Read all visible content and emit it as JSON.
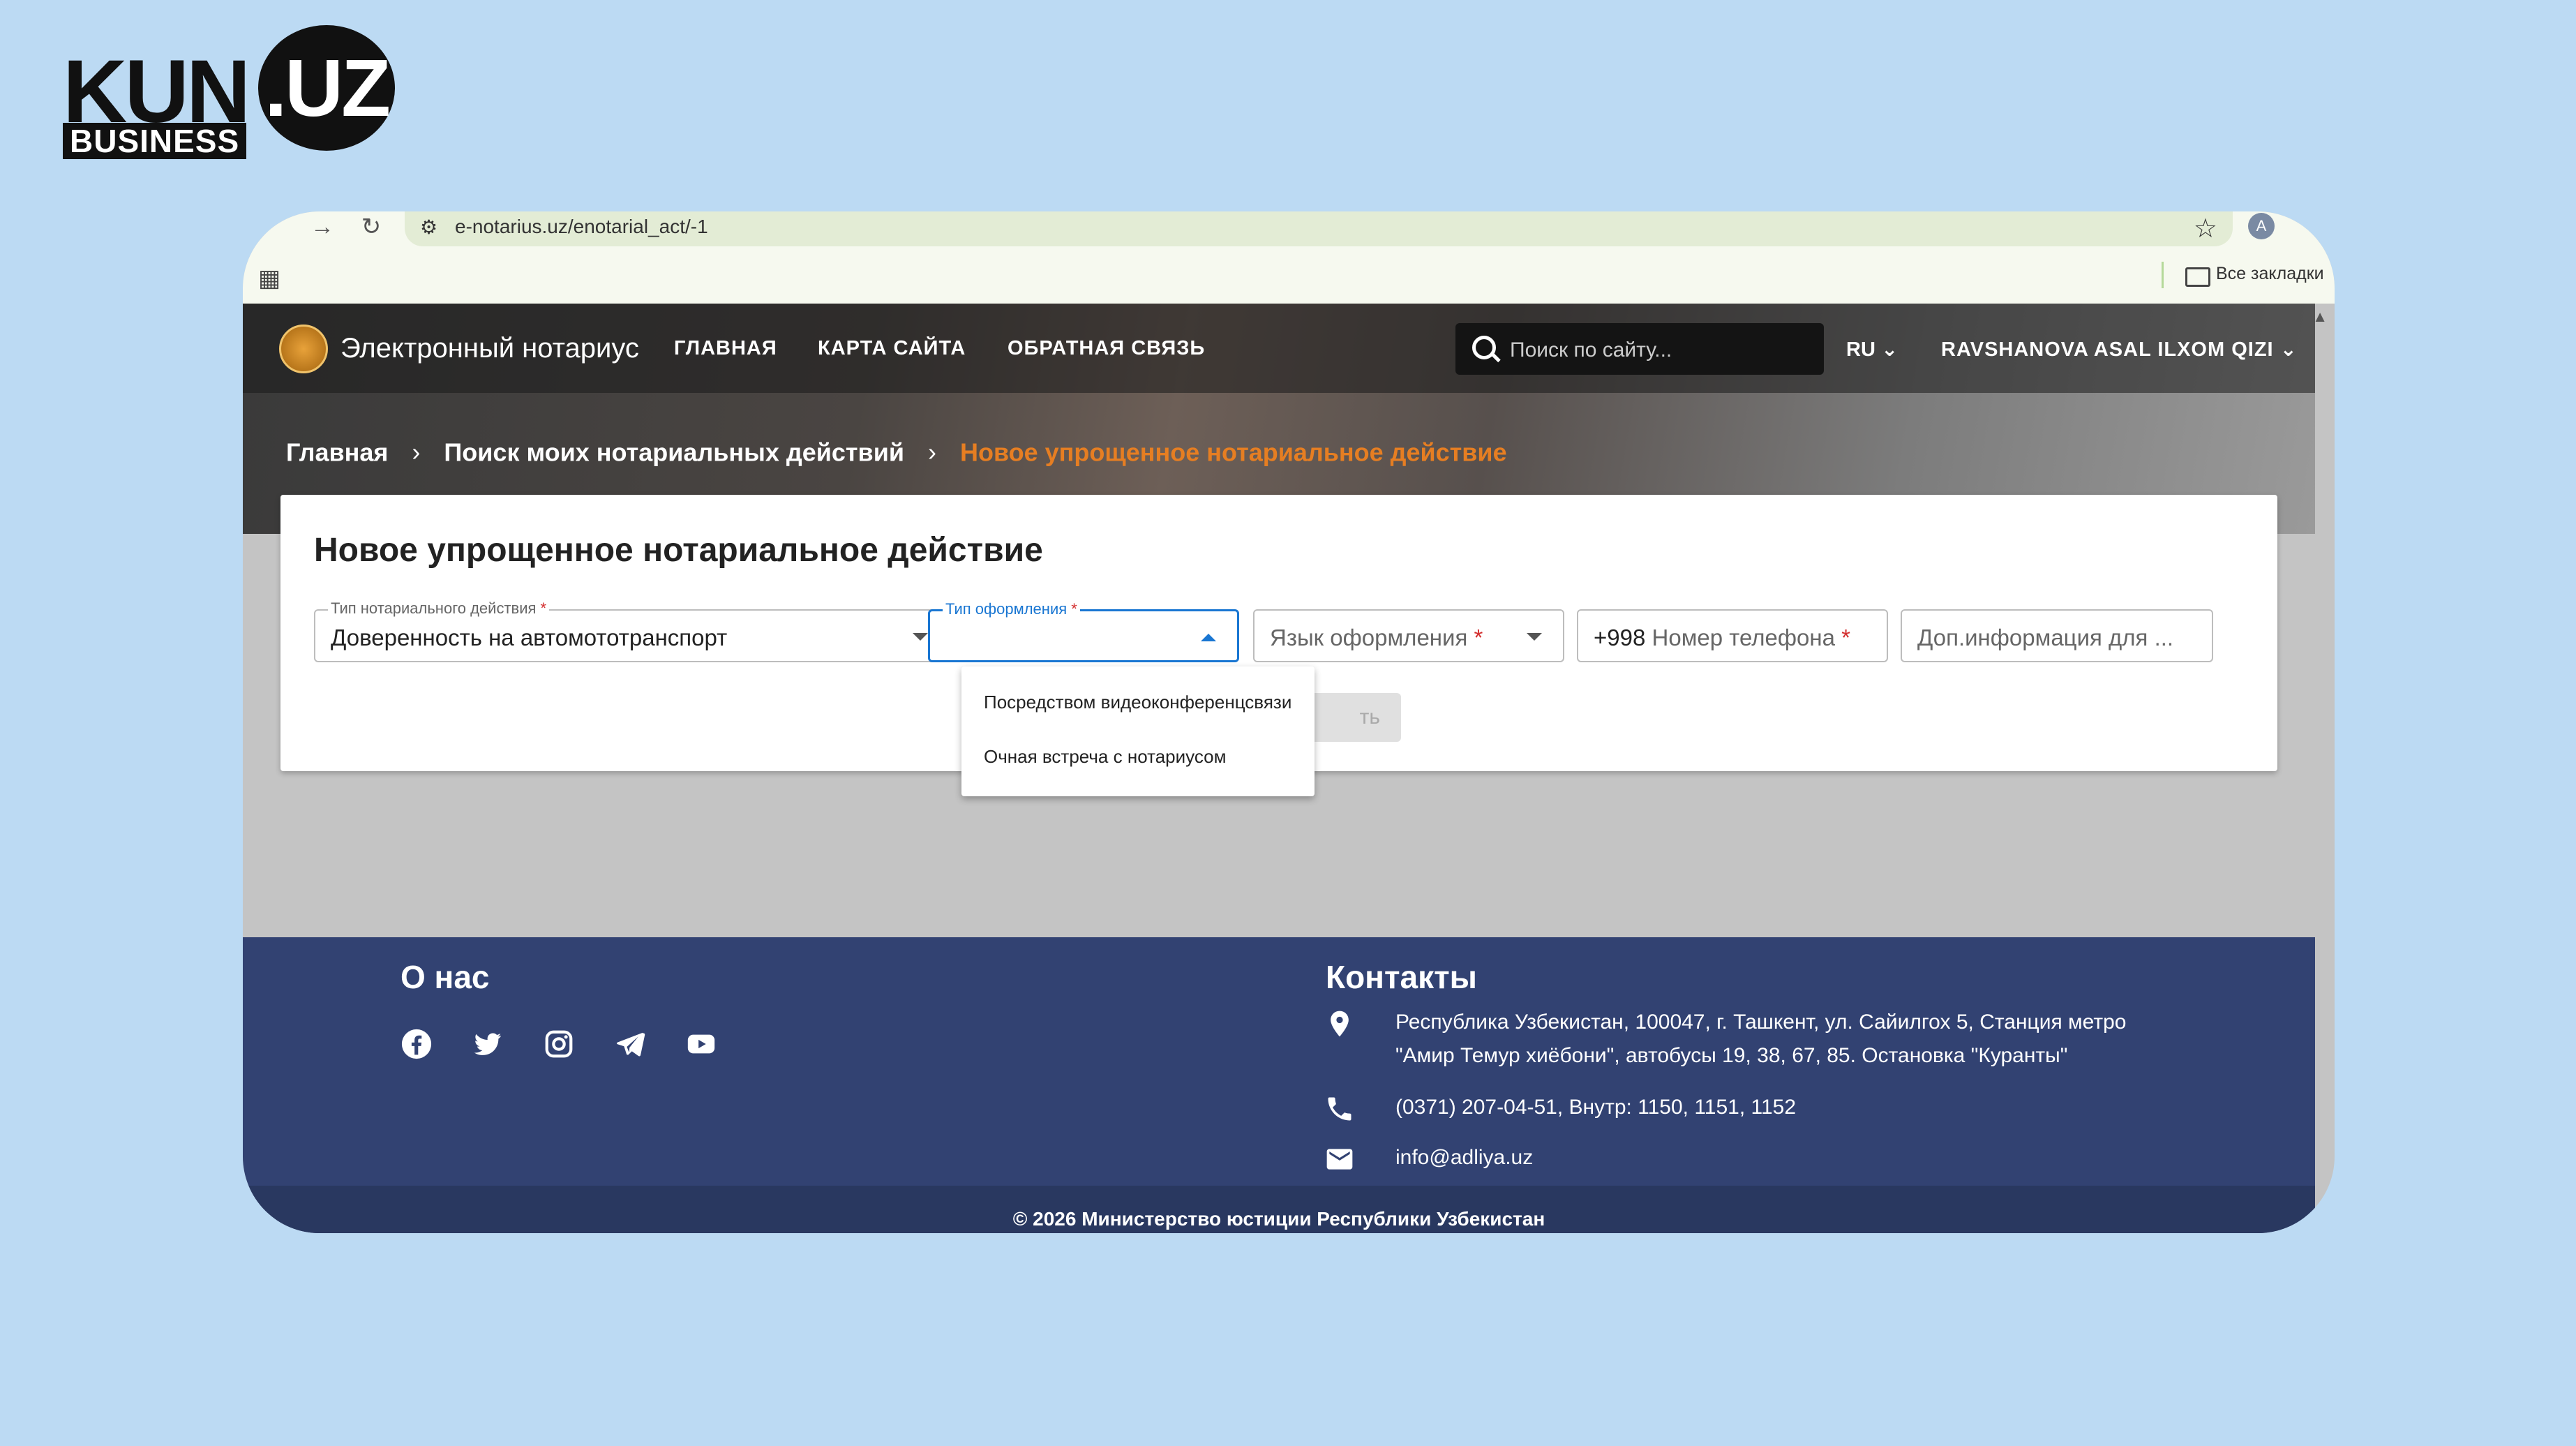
{
  "logo": {
    "kun": "KUN",
    "uz": ".UZ",
    "business": "BUSINESS"
  },
  "browser": {
    "url": "e-notarius.uz/enotarial_act/-1",
    "bookmarks_label": "Все закладки",
    "avatar_letter": "A"
  },
  "header": {
    "brand": "Электронный нотариус",
    "menu": [
      "ГЛАВНАЯ",
      "КАРТА САЙТА",
      "ОБРАТНАЯ СВЯЗЬ"
    ],
    "search_placeholder": "Поиск по сайту...",
    "lang": "RU",
    "user": "RAVSHANOVA ASAL ILXOM QIZI"
  },
  "breadcrumb": {
    "items": [
      "Главная",
      "Поиск моих нотариальных действий",
      "Новое упрощенное нотариальное действие"
    ]
  },
  "form": {
    "title": "Новое упрощенное нотариальное действие",
    "fields": {
      "act_type_label": "Тип нотариального действия",
      "act_type_value": "Доверенность на автомототранспорт",
      "format_label": "Тип оформления",
      "language_placeholder": "Язык оформления",
      "phone_prefix": "+998",
      "phone_placeholder": "Номер телефона",
      "extra_placeholder": "Доп.информация для ..."
    },
    "submit_visible": "ть"
  },
  "dropdown": {
    "options": [
      "Посредством видеоконференцсвязи",
      "Очная встреча с нотариусом"
    ]
  },
  "footer": {
    "about_title": "О нас",
    "contacts_title": "Контакты",
    "address_line1": "Республика Узбекистан, 100047, г. Ташкент, ул. Сайилгох 5, Станция метро",
    "address_line2": "\"Амир Темур хиёбони\", автобусы 19, 38, 67, 85. Остановка \"Куранты\"",
    "phone": "(0371) 207-04-51, Внутр: 1150, 1151, 1152",
    "email": "info@adliya.uz",
    "copyright": "© 2026 Министерство юстиции Республики Узбекистан"
  },
  "colors": {
    "page_bg": "#bcdaf3",
    "footer_bg": "#324272",
    "accent_orange": "#e67e22",
    "focus_blue": "#1976d2"
  }
}
